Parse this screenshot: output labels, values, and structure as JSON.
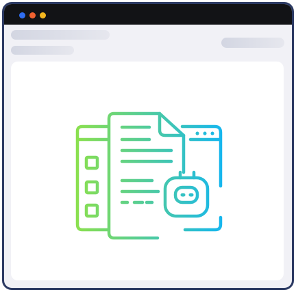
{
  "window": {
    "title_dots": [
      {
        "name": "blue",
        "color": "#2f6df0"
      },
      {
        "name": "orange",
        "color": "#f06230"
      },
      {
        "name": "yellow",
        "color": "#f3b61f"
      }
    ],
    "frame_color": "#2c3a63",
    "titlebar_color": "#121316"
  },
  "header": {
    "placeholders": [
      "title",
      "subtitle",
      "action"
    ]
  },
  "main": {
    "illustration": {
      "icon": "document-automation-robot-icon",
      "gradient": [
        "#8be04e",
        "#14b6f0"
      ]
    }
  }
}
